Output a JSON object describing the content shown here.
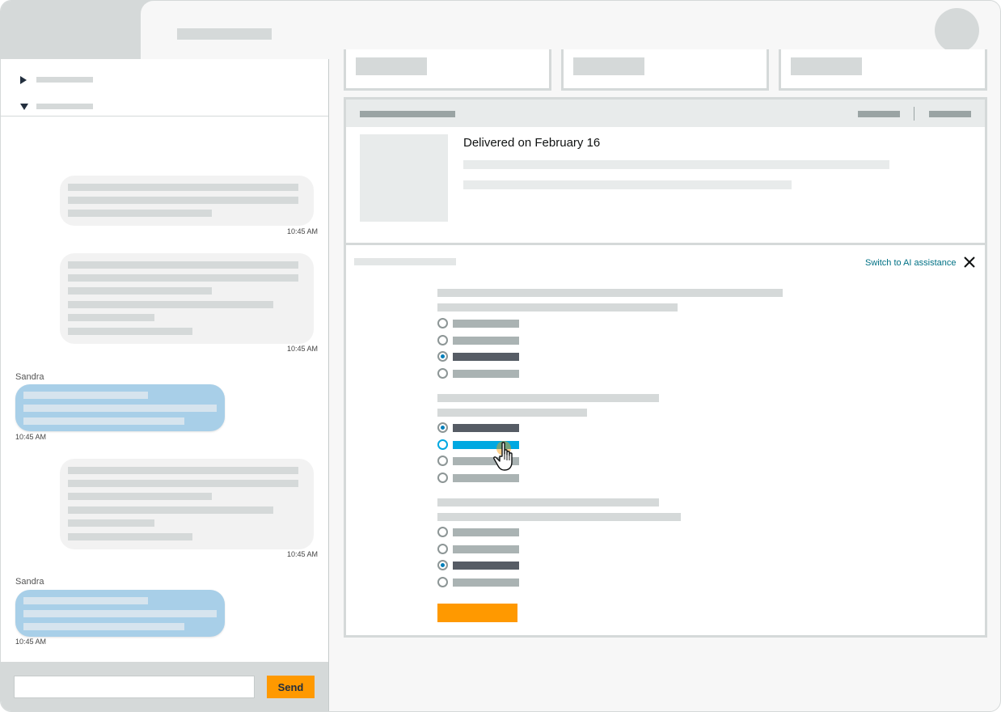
{
  "chat": {
    "messages": [
      {
        "role": "agent",
        "time": "10:45 AM"
      },
      {
        "role": "agent",
        "time": "10:45 AM"
      },
      {
        "role": "user",
        "sender": "Sandra",
        "time": "10:45 AM"
      },
      {
        "role": "agent",
        "time": "10:45 AM"
      },
      {
        "role": "user",
        "sender": "Sandra",
        "time": "10:45 AM"
      }
    ],
    "send_label": "Send",
    "input_value": ""
  },
  "order": {
    "delivered_text": "Delivered on February 16"
  },
  "survey": {
    "ai_link": "Switch to AI assistance",
    "questions": [
      {
        "selected_index": 2
      },
      {
        "selected_index": 0,
        "hover_index": 1
      },
      {
        "selected_index": 2
      }
    ]
  },
  "colors": {
    "accent": "#ff9900",
    "link": "#007185",
    "radio_selected": "#007eb9",
    "hover": "#00a8e1",
    "user_bubble": "#a8cfe8"
  },
  "icons": [
    "triangle-right-icon",
    "triangle-down-icon",
    "close-icon",
    "pointer-hand-icon"
  ]
}
